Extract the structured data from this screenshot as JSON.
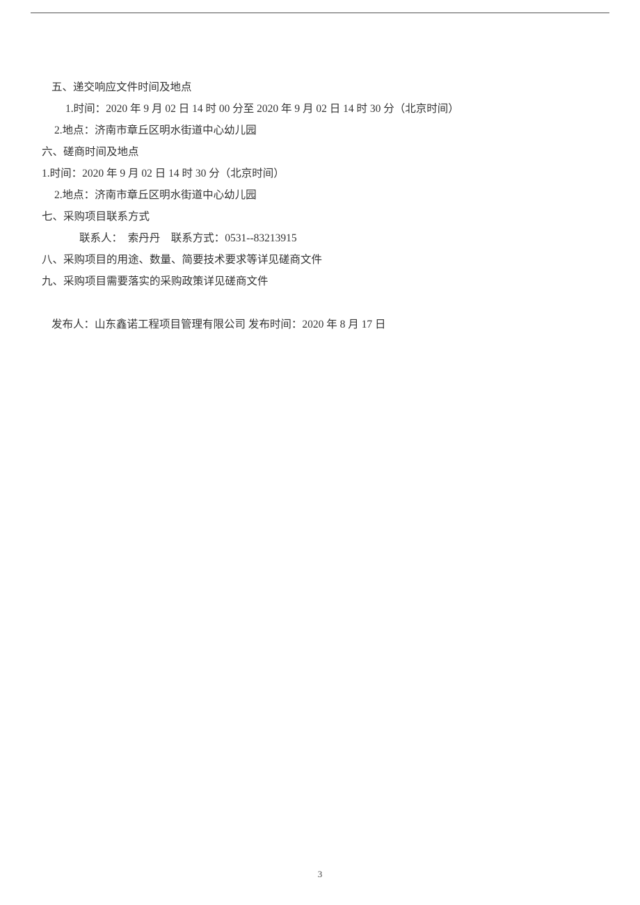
{
  "section5": {
    "heading": "五、递交响应文件时间及地点",
    "item1": "1.时间：2020 年 9 月 02 日 14 时 00 分至 2020 年 9 月 02 日 14 时 30 分（北京时间）",
    "item2": "2.地点：济南市章丘区明水街道中心幼儿园"
  },
  "section6": {
    "heading": "六、磋商时间及地点",
    "item1": "1.时间：2020 年 9 月 02 日 14 时 30 分（北京时间）",
    "item2": "2.地点：济南市章丘区明水街道中心幼儿园"
  },
  "section7": {
    "heading": "七、采购项目联系方式",
    "contact": "联系人：  索丹丹    联系方式：0531--83213915"
  },
  "section8": {
    "heading": "八、采购项目的用途、数量、简要技术要求等详见磋商文件"
  },
  "section9": {
    "heading": "九、采购项目需要落实的采购政策详见磋商文件"
  },
  "publisher": {
    "line": "发布人：山东鑫诺工程项目管理有限公司 发布时间：2020 年 8 月 17 日"
  },
  "page_number": "3"
}
